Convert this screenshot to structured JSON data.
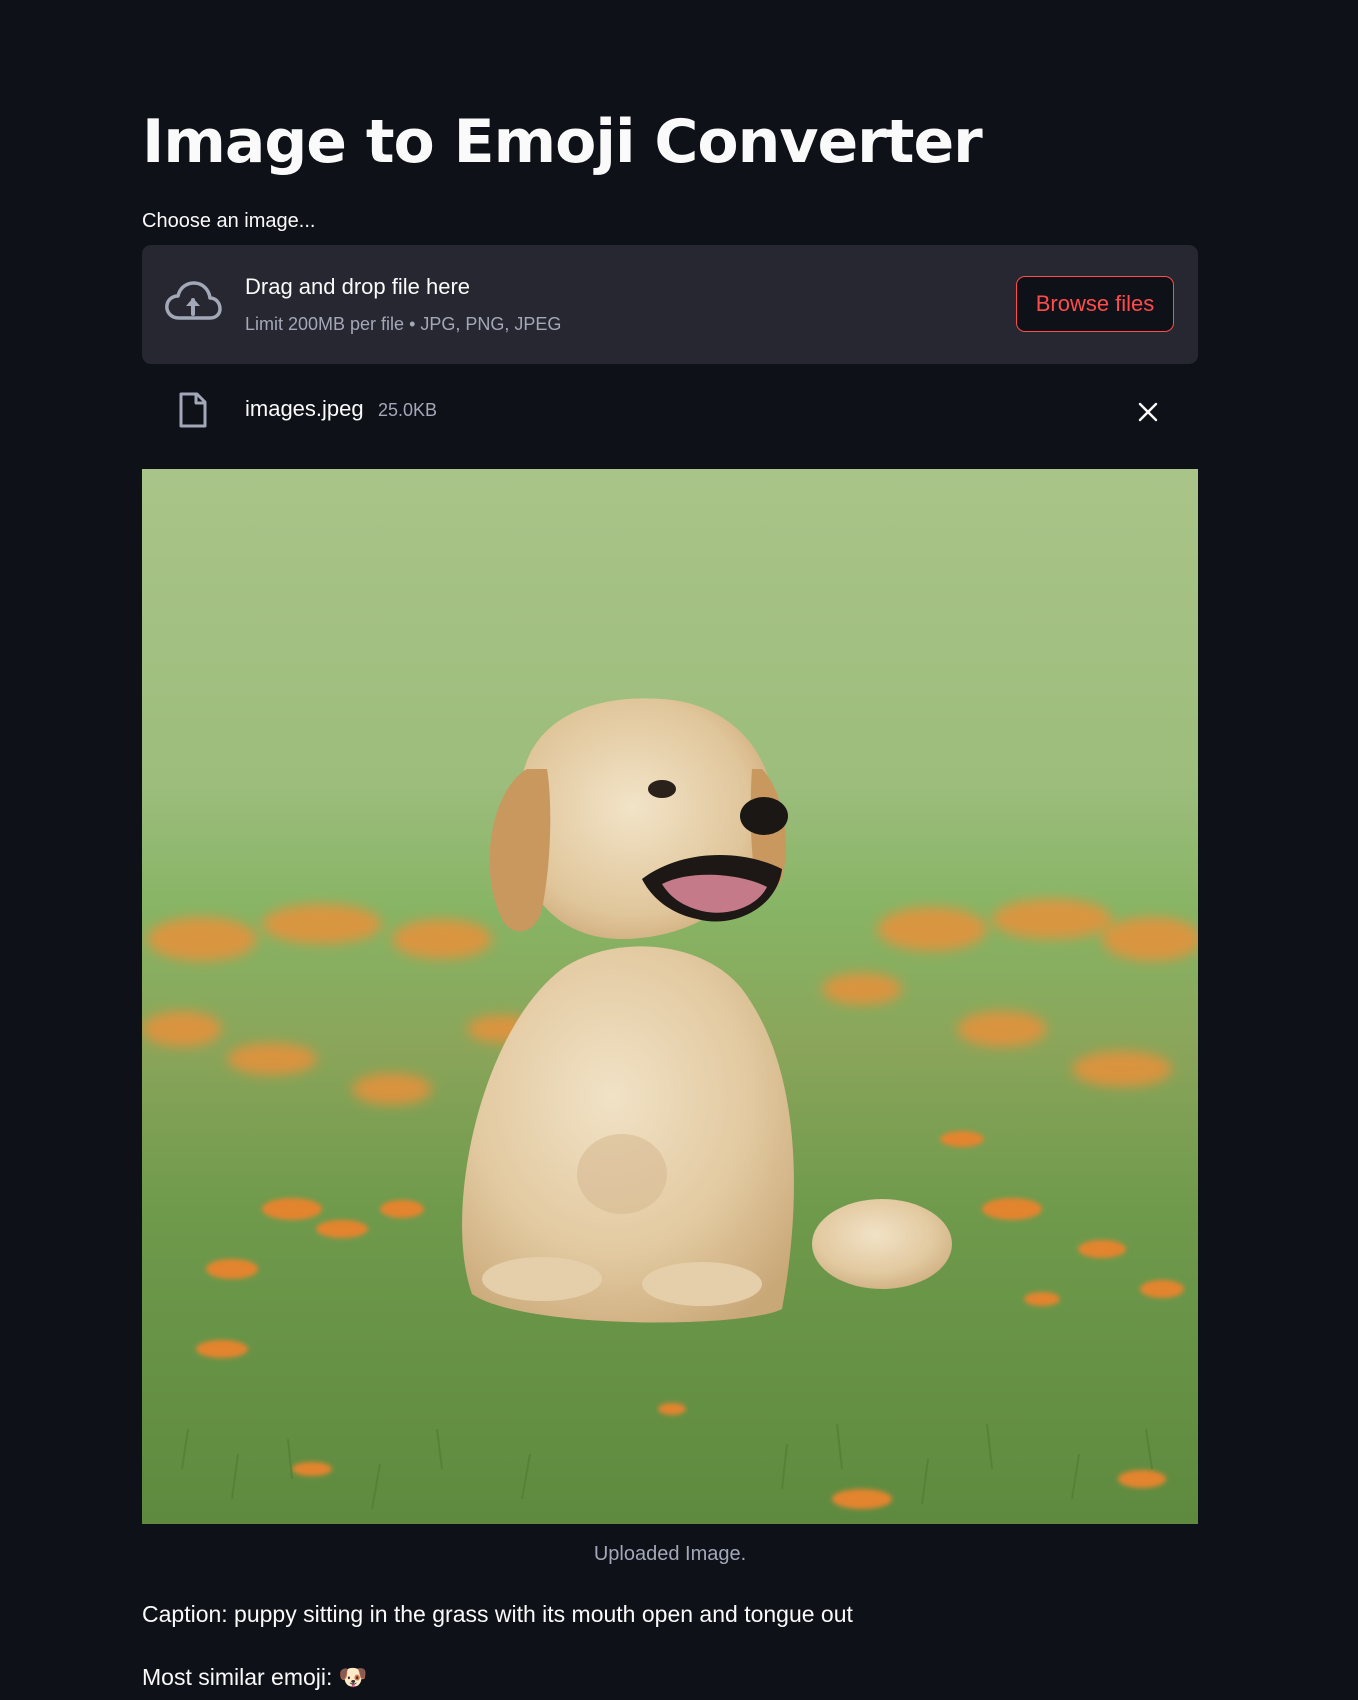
{
  "page": {
    "title": "Image to Emoji Converter"
  },
  "uploader": {
    "label": "Choose an image...",
    "drop_title": "Drag and drop file here",
    "limit_text": "Limit 200MB per file • JPG, PNG, JPEG",
    "browse_label": "Browse files",
    "upload_icon": "cloud-upload-icon"
  },
  "uploaded_file": {
    "name": "images.jpeg",
    "size": "25.0KB",
    "file_icon": "file-icon",
    "remove_icon": "close-icon"
  },
  "image": {
    "caption": "Uploaded Image."
  },
  "result": {
    "caption_line": "Caption: puppy sitting in the grass with its mouth open and tongue out",
    "emoji_line": "Most similar emoji: 🐶"
  },
  "colors": {
    "background": "#0e1117",
    "dropzone": "#262730",
    "accent": "#ff4b4b",
    "text": "#fafafa",
    "muted_text": "#a3a8b8"
  }
}
